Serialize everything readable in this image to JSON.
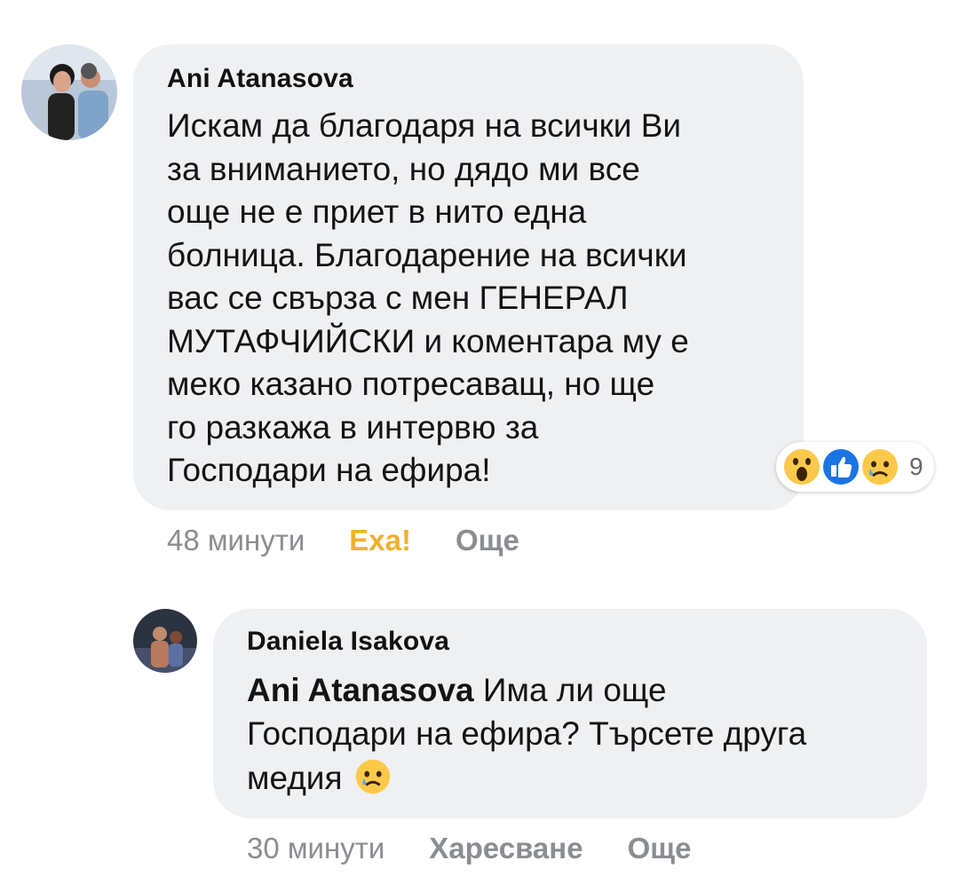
{
  "comment": {
    "author": "Ani Atanasova",
    "text": "Искам да благодаря на всички Ви\nза вниманието, но дядо ми все\nоще не е приет в нито една\nболница. Благодарение на всички\nвас се свърза с мен ГЕНЕРАЛ\nМУТАФЧИЙСКИ и коментара му е\nмеко казано потресаващ, но ще\nго разкажа в интервю за\nГосподари на ефира!",
    "time": "48 минути",
    "reaction_label": "Еха!",
    "more_label": "Още",
    "reaction_count": "9",
    "reaction_icons": [
      "wow-icon",
      "like-icon",
      "sad-icon"
    ],
    "reaction_color": "#f0b12c"
  },
  "reply": {
    "author": "Daniela Isakova",
    "mention": "Ani Atanasova",
    "text_line1": " Има ли още",
    "text_rest": "Господари на ефира? Търсете друга\nмедия ",
    "emoji": "sad-icon",
    "time": "30 минути",
    "like_label": "Харесване",
    "more_label": "Още"
  }
}
